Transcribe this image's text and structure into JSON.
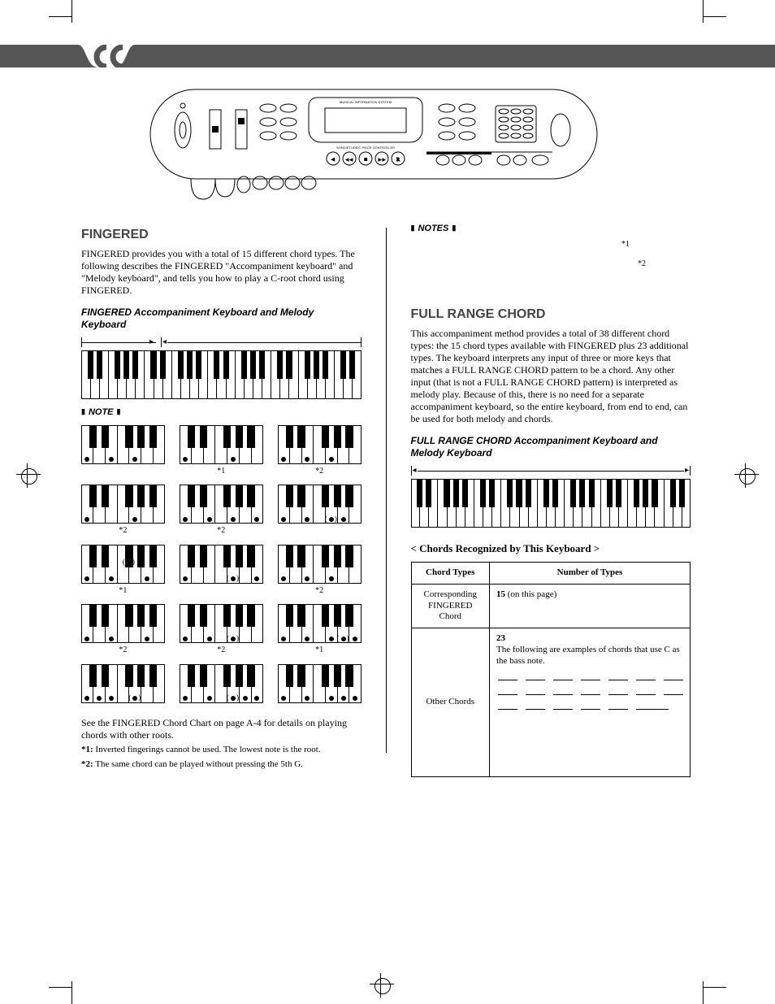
{
  "left": {
    "heading": "FINGERED",
    "intro": "FINGERED provides you with a total of 15 different chord types. The following describes the FINGERED  \"Accompaniment keyboard\" and \"Melody keyboard\", and tells you how to play a C-root chord using FINGERED.",
    "sub1": "FINGERED Accompaniment Keyboard and Melody Keyboard",
    "note_label": "NOTE",
    "grid_footnotes": {
      "r1": [
        "",
        "*1",
        "*2"
      ],
      "r2": [
        "*2",
        "*2",
        ""
      ],
      "r3": [
        "*1",
        "",
        "*2"
      ],
      "r4": [
        "*2",
        "*2",
        "*1"
      ],
      "r5": [
        "",
        "",
        ""
      ]
    },
    "after_grid": "See the FINGERED Chord Chart on page A-4 for details on playing chords with other roots.",
    "fn1_label": "*1:",
    "fn1_text": " Inverted fingerings cannot be used. The lowest note is the root.",
    "fn2_label": "*2:",
    "fn2_text": " The same chord can be played without pressing the 5th G."
  },
  "right": {
    "notes_label": "NOTES",
    "star1": "*1",
    "star2": "*2",
    "heading": "FULL RANGE CHORD",
    "intro": "This accompaniment method provides a total of 38 different chord types: the 15 chord types available with FINGERED plus 23 additional types. The keyboard interprets any input of three or more keys that matches a FULL RANGE CHORD pattern to be a chord. Any other input (that is not a FULL RANGE CHORD pattern) is interpreted as melody play. Because of this, there is no need for a separate accompaniment keyboard, so the entire keyboard, from end to end, can be used for both melody and chords.",
    "sub1": "FULL RANGE CHORD Accompaniment Keyboard and Melody Keyboard",
    "table_caption": "< Chords Recognized by This Keyboard >",
    "table": {
      "h1": "Chord Types",
      "h2": "Number of Types",
      "r1c1": "Corresponding FINGERED Chord",
      "r1c2_bold": "15",
      "r1c2_rest": " (on this page)",
      "r2c1": "Other Chords",
      "r2c2_bold": "23",
      "r2c2_line": "The following are examples of chords that use C as the bass note."
    }
  }
}
